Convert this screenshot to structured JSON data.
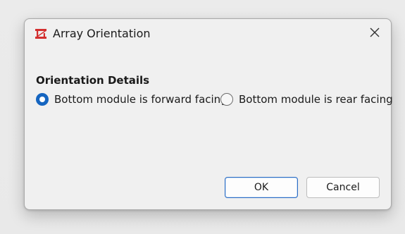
{
  "window": {
    "title": "Array Orientation",
    "app_icon": "array-app-icon",
    "close_icon": "close-icon"
  },
  "section": {
    "heading": "Orientation Details"
  },
  "orientation_options": [
    {
      "label": "Bottom module is forward facing",
      "selected": true
    },
    {
      "label": "Bottom module is rear facing",
      "selected": false
    }
  ],
  "buttons": {
    "ok_label": "OK",
    "cancel_label": "Cancel"
  },
  "colors": {
    "accent": "#1565c0",
    "app_icon": "#d32f2f",
    "dialog_bg": "#f0f0f0"
  }
}
